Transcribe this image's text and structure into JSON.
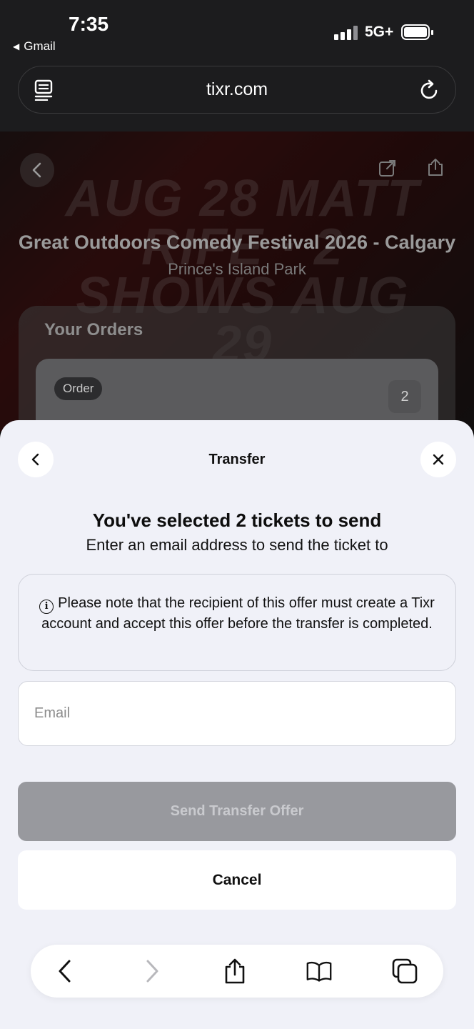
{
  "status_bar": {
    "time": "7:35",
    "back_app": "Gmail",
    "network": "5G+"
  },
  "browser": {
    "url": "tixr.com"
  },
  "background_page": {
    "hero_text": "AUG 28 MATT RIFE · 2 SHOWS AUG 29",
    "event_title": "Great Outdoors Comedy Festival 2026 - Calgary",
    "venue": "Prince's Island Park",
    "orders_heading": "Your Orders",
    "order_badge": "Order",
    "order_count": "2"
  },
  "sheet": {
    "title": "Transfer",
    "headline": "You've selected 2 tickets to send",
    "subline": "Enter an email address to send the ticket to",
    "note": "Please note that the recipient of this offer must create a Tixr account and accept this offer before the transfer is completed.",
    "email_placeholder": "Email",
    "email_value": "",
    "send_label": "Send Transfer Offer",
    "cancel_label": "Cancel"
  },
  "toolbar": {
    "icons": [
      "back-icon",
      "forward-icon",
      "share-icon",
      "bookmarks-icon",
      "tabs-icon"
    ]
  },
  "colors": {
    "sheet_bg": "#f0f1f8",
    "disabled_button": "#98999e",
    "topbar": "#1c1c1e"
  }
}
